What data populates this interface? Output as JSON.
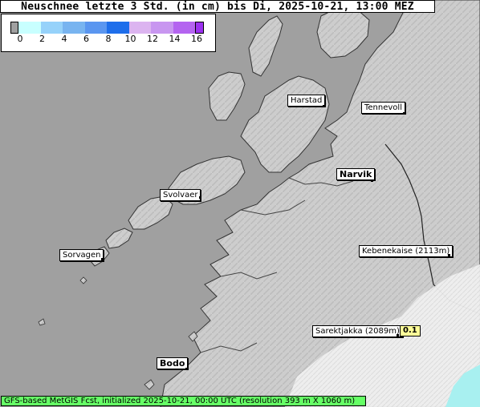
{
  "title": "Neuschnee letzte 3 Std. (in cm) bis Di, 2025-10-21, 13:00 MEZ",
  "legend": {
    "ticks": [
      "0",
      "2",
      "4",
      "6",
      "8",
      "10",
      "12",
      "14",
      "16"
    ],
    "colors": [
      "#c8ffff",
      "#96d2fa",
      "#78b4f0",
      "#5a96f0",
      "#1e6eeb",
      "#dcb4f0",
      "#c896f0",
      "#b464f0",
      "#9b30f0"
    ]
  },
  "places": {
    "harstad": "Harstad",
    "tennevoll": "Tennevoll",
    "narvik": "Narvik",
    "svolvaer": "Svolvaer",
    "sorvagen": "Sorvagen",
    "kebnekaise": "Kebenekaise (2113m)",
    "sarektjakka": "Sarektjakka (2089m)",
    "bodo": "Bodo"
  },
  "value_sarektjakka": "0.1",
  "footer": "GFS-based MetGIS Fcst, initialized 2025-10-21, 00:00 UTC  (resolution 393 m X 1060 m)",
  "colors": {
    "sea": "#a0a0a0",
    "land": "#cfcfcf",
    "snow": "#f2f2f2",
    "footer": "#66ff66"
  }
}
